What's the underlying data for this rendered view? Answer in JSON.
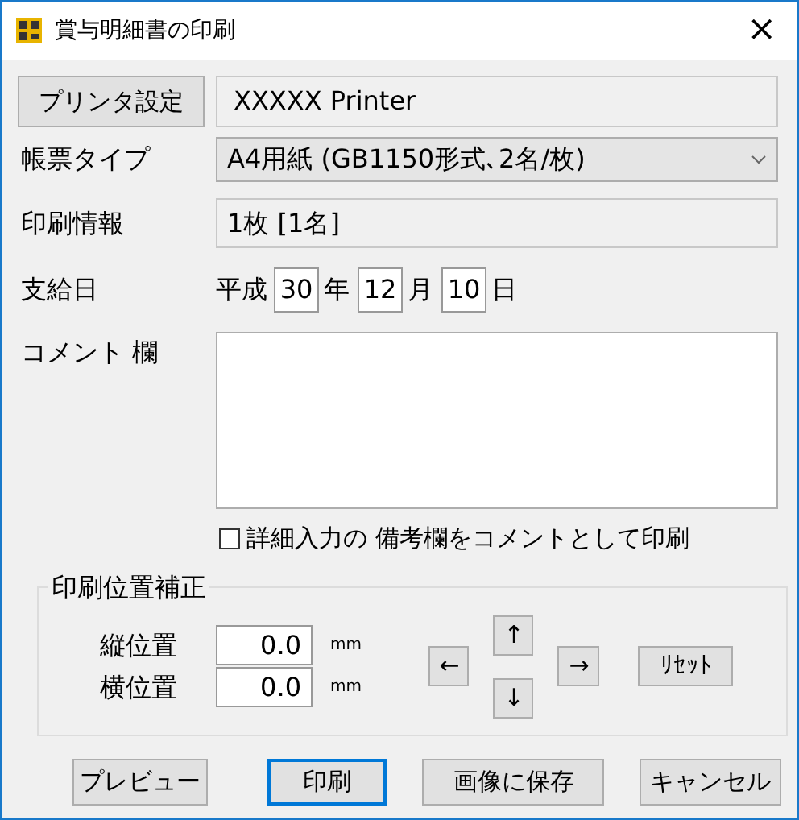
{
  "window": {
    "title": "賞与明細書の印刷",
    "close": "×"
  },
  "printer": {
    "button": "プリンタ設定",
    "name": "XXXXX Printer"
  },
  "form_type": {
    "label": "帳票タイプ",
    "value": "A4用紙 (GB1150形式､2名/枚)"
  },
  "print_info": {
    "label": "印刷情報",
    "value": "1枚 [1名]"
  },
  "pay_date": {
    "label": "支給日",
    "era": "平成",
    "year": "30",
    "year_unit": "年",
    "month": "12",
    "month_unit": "月",
    "day": "10",
    "day_unit": "日"
  },
  "comment": {
    "label": "コメント 欄"
  },
  "remarks_checkbox": {
    "label": "詳細入力の 備考欄をコメントとして印刷",
    "checked": false
  },
  "position": {
    "title": "印刷位置補正",
    "fields": [
      {
        "label": "縦位置",
        "value": "0.0",
        "unit": "mm"
      },
      {
        "label": "横位置",
        "value": "0.0",
        "unit": "mm"
      }
    ],
    "left": "←",
    "up": "↑",
    "down": "↓",
    "right": "→",
    "reset": "ﾘｾｯﾄ"
  },
  "buttons": [
    {
      "label": "プレビュー",
      "focused": false
    },
    {
      "label": "印刷",
      "focused": true
    },
    {
      "label": "画像に保存",
      "focused": false
    },
    {
      "label": "キャンセル",
      "focused": false
    }
  ]
}
